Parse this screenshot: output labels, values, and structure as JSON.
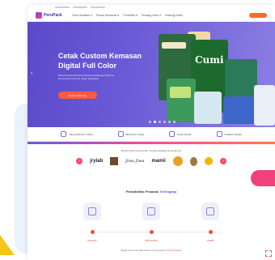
{
  "nav": {
    "logo": "PeruPack",
    "items": [
      "Cari Kemasan ▾",
      "Pesan Kemasan ▾",
      "Portofolio ▾",
      "Tentang Kami ▾",
      "Hubungi Kami"
    ]
  },
  "hero": {
    "title_line1": "Cetak Custom Kemasan",
    "title_line2": "Digital Full Color",
    "description": "Mulai Produksi Kemasan Brand Anda Dengan Minimum Pemesanan Kecil dan Harga Terjangkau",
    "cta_label": "Pesan Sekarang",
    "pouch_label": "Cumi",
    "slide_count": 6,
    "active_slide": 2
  },
  "features": [
    {
      "icon": "box-icon",
      "label": "Tanpa Minimum Order"
    },
    {
      "icon": "truck-icon",
      "label": "Bisa Kirim Cepat"
    },
    {
      "icon": "pen-icon",
      "label": "Gratis Desain"
    },
    {
      "icon": "shield-icon",
      "label": "Kualitas Terbaik"
    }
  ],
  "clients": {
    "title": "Brand-brand yang sudah mempercayakan kemasannya",
    "brands": [
      "jrylab",
      "Jiwa Jiwa",
      "mamii"
    ]
  },
  "process": {
    "title_plain": "Fleksibilitas Pesanan",
    "title_highlight": "Terlengkap",
    "steps": [
      "DESAIN",
      "PRODUKSI",
      "KIRIM"
    ]
  },
  "footer_note": {
    "text": "Bagaimana Cara Memesan di Perupack?",
    "link": "Lihat Panduan"
  },
  "colors": {
    "primary": "#5b49c9",
    "accent": "#ff5b3a",
    "pink": "#f04e6a",
    "yellow": "#f5c518"
  }
}
